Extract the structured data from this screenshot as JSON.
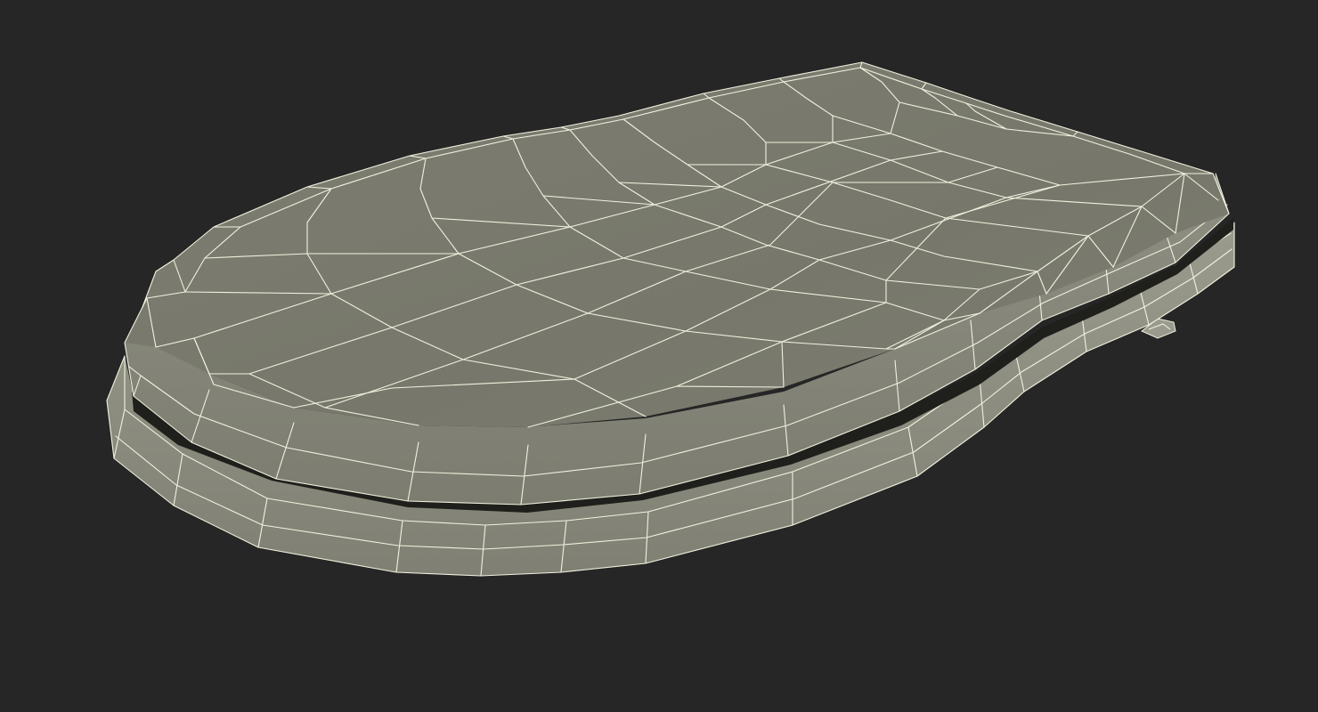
{
  "viewport": {
    "background_color": "#262626"
  },
  "model": {
    "object": "toilet-seat-with-lid",
    "render_style": "wireframe-over-shaded",
    "colors": {
      "lid_top": "#7a7b6e",
      "lid_side": "#8a8b7e",
      "seat_side": "#8c8d80",
      "shadow_gap": "#1f1f1c",
      "wire": "#f2f1df"
    }
  }
}
